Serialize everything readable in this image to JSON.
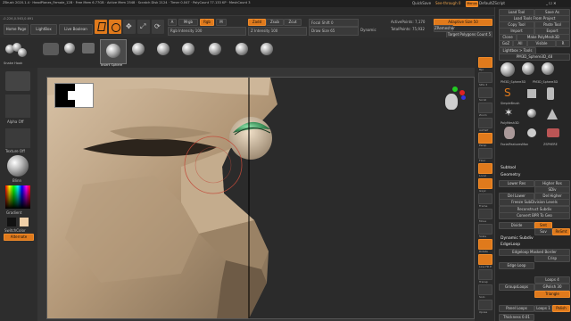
{
  "titlebar": {
    "text": "ZBrush 2020.1.4  ·  HeadPlanes_Female_12B  ·  Free Mem 6.77GB  ·  Active Mem 2548  ·  Scratch Disk 2124  ·  Timer 0.047  ·  PolyCount 77.133 KP  ·  MeshCount 3",
    "quicksave": "QuickSave",
    "seethrough": "See-through 0",
    "menus_label": "Menus",
    "script": "DefaultZScript"
  },
  "menubar": [
    "Alpha",
    "Brush",
    "Color",
    "Document",
    "Draw",
    "Edit",
    "File",
    "Layer",
    "Light",
    "Macro",
    "Marker",
    "Material",
    "Movie",
    "Picker",
    "Preferences",
    "Render",
    "Stencil",
    "Stroke",
    "Texture",
    "Tool",
    "Transform",
    "Zplugin",
    "Zscript",
    "Help"
  ],
  "status_coords": "-0.226,0.563,0.691",
  "toolbar": {
    "home": "Home Page",
    "lightbox": "LightBox",
    "livebool": "Live Boolean",
    "a_label": "A",
    "mrgb": "Mrgb",
    "rgb": "Rgb",
    "m": "M",
    "zadd": "Zadd",
    "zsub": "Zsub",
    "zcut": "Zcut",
    "rgb_intensity": "Rgb Intensity 100",
    "z_intensity": "Z Intensity 100",
    "focal_shift": "Focal Shift 0",
    "draw_size": "Draw Size 65",
    "dynamic": "Dynamic",
    "active_points": "ActivePoints: 7,170",
    "total_points": "TotalPoints: 75,932",
    "adaptive": "Adaptive Size 50",
    "zremesher": "ZRemesher",
    "target_polygons": "Target Polygons Count 5"
  },
  "shelf": {
    "brush_label": "Snake Hook",
    "selected_label": "Insert Sphere"
  },
  "leftpanel": {
    "alpha_off": "Alpha Off",
    "texture_off": "Texture Off",
    "material": "Blinn",
    "gradient": "Gradient",
    "switch_color": "SwitchColor",
    "alternate": "Alternate"
  },
  "tray": {
    "load_tool": "Load Tool",
    "save_as": "Save As",
    "load_tools_from_project": "Load Tools From Project",
    "copy_tool": "Copy Tool",
    "paste_tool": "Paste Tool",
    "import": "Import",
    "export": "Export",
    "clone": "Clone",
    "make_polymesh": "Make PolyMesh3D",
    "goz": "GoZ",
    "all": "All",
    "visible": "Visible",
    "r": "R",
    "lightbox_tools": "Lightbox > Tools",
    "current_tool": "PM3D_Sphere3D_48",
    "tool_items": [
      "PM3D_Sphere3D",
      "PM3D_Sphere3D",
      "SimpleBrush",
      "PolyMesh3D",
      "Cylinder3D",
      "FacialFeaturesMan",
      "ZSPHERE",
      "Cone3D"
    ],
    "subtool": "Subtool",
    "geometry": "Geometry",
    "lower_res": "Lower Res",
    "higher_res": "Higher Res",
    "sdiv": "SDiv",
    "del_lower": "Del Lower",
    "del_higher": "Del Higher",
    "freeze_subdiv": "Freeze SubDivision Levels",
    "reconstruct_subdiv": "Reconstruct Subdiv",
    "convert_bpr": "Convert BPR To Geo",
    "divide": "Divide",
    "smt": "Smt",
    "suv": "Suv",
    "rsmt": "ReSmt",
    "dynamic_subdiv": "Dynamic Subdiv",
    "edgeloop": "EdgeLoop",
    "edgeloop_masked": "Edgeloop Masked Border",
    "crisp": "Crisp",
    "edge_loop": "Edge Loop",
    "groups_loops": "GroupsLoops",
    "loops": "Loops 4",
    "polish": "GPolish 30",
    "triangle": "Triangle",
    "panel_loops": "Panel Loops",
    "loops2": "Loops 1",
    "polish2": "Polish",
    "thickness": "Thickness 0.01"
  },
  "rightstrip": [
    "Bpr",
    "SPix 3",
    "Scroll",
    "Zoom",
    "AAHalf",
    "Persp",
    "Floor",
    "Local",
    "Gxyz",
    "Frame",
    "Move",
    "Scale",
    "Rotate",
    "Line Fill PolyF",
    "Transp",
    "Solo",
    "Xpose"
  ]
}
